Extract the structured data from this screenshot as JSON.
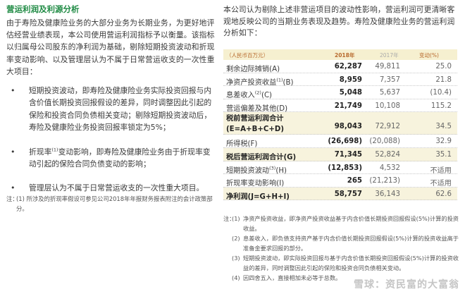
{
  "left": {
    "title": "营运利润及利源分析",
    "paragraph": "由于寿险及健康险业务的大部分业务为长期业务，为更好地评估经营业绩表现，本公司使用营运利润指标予以衡量。该指标以归属母公司股东的净利润为基础，剔除短期投资波动和折现率变动影响、以及管理层认为不属于日常营运收支的一次性重大项目：",
    "bullets": [
      {
        "pre": "短期投资波动，即寿险及健康险业务实际投资回报与内含价值长期投资回报假设的差异，同时调整因此引起的保险和投资合同负债相关变动；剔除短期投资波动后，寿险及健康险业务投资回报率锁定为5%；",
        "sup": ""
      },
      {
        "pre": "折现率",
        "sup": "(1)",
        "post": "变动影响，即寿险及健康险业务由于折现率变动引起的保险合同负债变动的影响；"
      },
      {
        "pre": "管理层认为不属于日常营运收支的一次性重大项目。",
        "sup": ""
      }
    ],
    "note_tag": "注：",
    "note": "(1) 所涉及的折现率假设可参见公司2018年年报财务报表附注的会计政策部分。"
  },
  "right": {
    "paragraph": "本公司认为剔除上述非营运项目的波动性影响，营运利润可更清晰客观地反映公司的当期业务表现及趋势。寿险及健康险业务的营运利润分析如下：",
    "table": {
      "header": {
        "unit": "（人民币百万元）",
        "y2018": "2018年",
        "y2017": "2017年",
        "change": "变动(%)"
      },
      "rows": [
        {
          "label": "剩余边际摊销(A)",
          "sup": "",
          "v2018": "62,287",
          "v2017": "49,811",
          "chg": "25.0",
          "type": "normal"
        },
        {
          "label": "净资产投资收益",
          "sup": "(1)",
          "suffix": "(B)",
          "v2018": "8,959",
          "v2017": "7,357",
          "chg": "21.8",
          "type": "normal"
        },
        {
          "label": "息差收入",
          "sup": "(2)",
          "suffix": "(C)",
          "v2018": "5,048",
          "v2017": "5,637",
          "chg": "(10.4)",
          "type": "normal"
        },
        {
          "label": "营运偏差及其他(D)",
          "sup": "",
          "v2018": "21,749",
          "v2017": "10,108",
          "chg": "115.2",
          "type": "normal"
        },
        {
          "label": "税前营运利润合计\n(E=A+B+C+D)",
          "sup": "",
          "v2018": "98,043",
          "v2017": "72,912",
          "chg": "34.5",
          "type": "tall-total"
        },
        {
          "label": "所得税(F)",
          "sup": "",
          "v2018": "(26,698)",
          "v2017": "(20,088)",
          "chg": "32.9",
          "type": "normal"
        },
        {
          "label": "税后营运利润合计(G)",
          "sup": "",
          "v2018": "71,345",
          "v2017": "52,824",
          "chg": "35.1",
          "type": "total"
        },
        {
          "label": "短期投资波动",
          "sup": "(3)",
          "suffix": "(H)",
          "v2018": "(12,853)",
          "v2017": "4,532",
          "chg": "不适用",
          "type": "normal"
        },
        {
          "label": "折现率变动影响(I)",
          "sup": "",
          "v2018": "265",
          "v2017": "(21,213)",
          "chg": "不适用",
          "type": "normal"
        },
        {
          "label": "净利润(J=G+H+I)",
          "sup": "",
          "v2018": "58,757",
          "v2017": "36,143",
          "chg": "62.6",
          "type": "total"
        }
      ]
    },
    "notes_tag": "注：",
    "notes": [
      {
        "num": "(1)",
        "text": "净资产投资收益，即净资产投资收益基于内含价值长期投资回报假设(5%)计算的投资收益。"
      },
      {
        "num": "(2)",
        "text": "息差收入，即负债支持资产基于内含价值长期投资回报假设(5%)计算的投资收益高于准备金要求回报的部分。"
      },
      {
        "num": "(3)",
        "text": "短期投资波动，即实际投资回报与基于内含价值长期投资回报假设(5%)计算的投资收益的差异，同时调整因此引起的保险和投资合同负债相关变动。"
      },
      {
        "num": "(4)",
        "text": "因四舍五入，直接相加未必等于总数。"
      }
    ]
  },
  "watermark": "雪球：资民富的大富翁",
  "colors": {
    "accent_green": "#1e8a43",
    "header_bg": "#f6f0d0",
    "header_text": "#b86a2e",
    "total_row_bg": "#f7f3dd"
  }
}
